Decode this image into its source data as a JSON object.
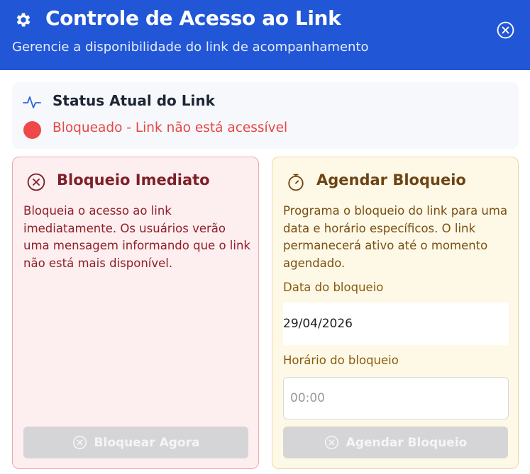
{
  "header": {
    "title": "Controle de Acesso ao Link",
    "subtitle": "Gerencie a disponibilidade do link de acompanhamento",
    "bg_color": "#2157d6",
    "icon": "gear-icon",
    "close_icon": "close-circle-icon"
  },
  "status": {
    "title": "Status Atual do Link",
    "text": "Bloqueado - Link não está acessível",
    "icon": "activity-pulse-icon",
    "dot_color": "#ef4848"
  },
  "immediate": {
    "title": "Bloqueio Imediato",
    "description": "Bloqueia o acesso ao link imediatamente. Os usuários verão uma mensagem informando que o link não está mais disponível.",
    "button_label": "Bloquear Agora",
    "icon": "x-circle-icon",
    "accent": "#7d1f27"
  },
  "schedule": {
    "title": "Agendar Bloqueio",
    "description": "Programa o bloqueio do link para uma data e horário específicos. O link permanecerá ativo até o momento agendado.",
    "date_label": "Data do bloqueio",
    "date_value": "29/04/2026",
    "time_label": "Horário do bloqueio",
    "time_placeholder": "00:00",
    "button_label": "Agendar Bloqueio",
    "icon": "timer-icon",
    "accent": "#6e4414"
  }
}
